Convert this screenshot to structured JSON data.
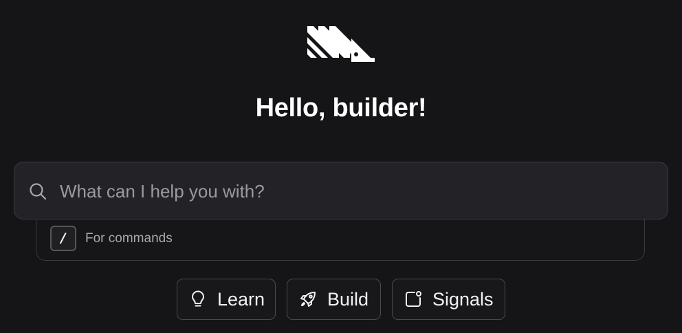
{
  "logo": {
    "icon": "hedgehog-logo-icon"
  },
  "greeting": "Hello, builder!",
  "search": {
    "placeholder": "What can I help you with?",
    "value": "",
    "icon": "search-icon"
  },
  "hint": {
    "key": "/",
    "text": "For commands"
  },
  "chips": [
    {
      "label": "Learn",
      "icon": "lightbulb-icon"
    },
    {
      "label": "Build",
      "icon": "rocket-icon"
    },
    {
      "label": "Signals",
      "icon": "notification-square-icon"
    }
  ],
  "colors": {
    "background": "#151517",
    "input_background": "#232327",
    "border": "#3c3c41",
    "text": "#ffffff",
    "muted_text": "#a8a8ad"
  }
}
